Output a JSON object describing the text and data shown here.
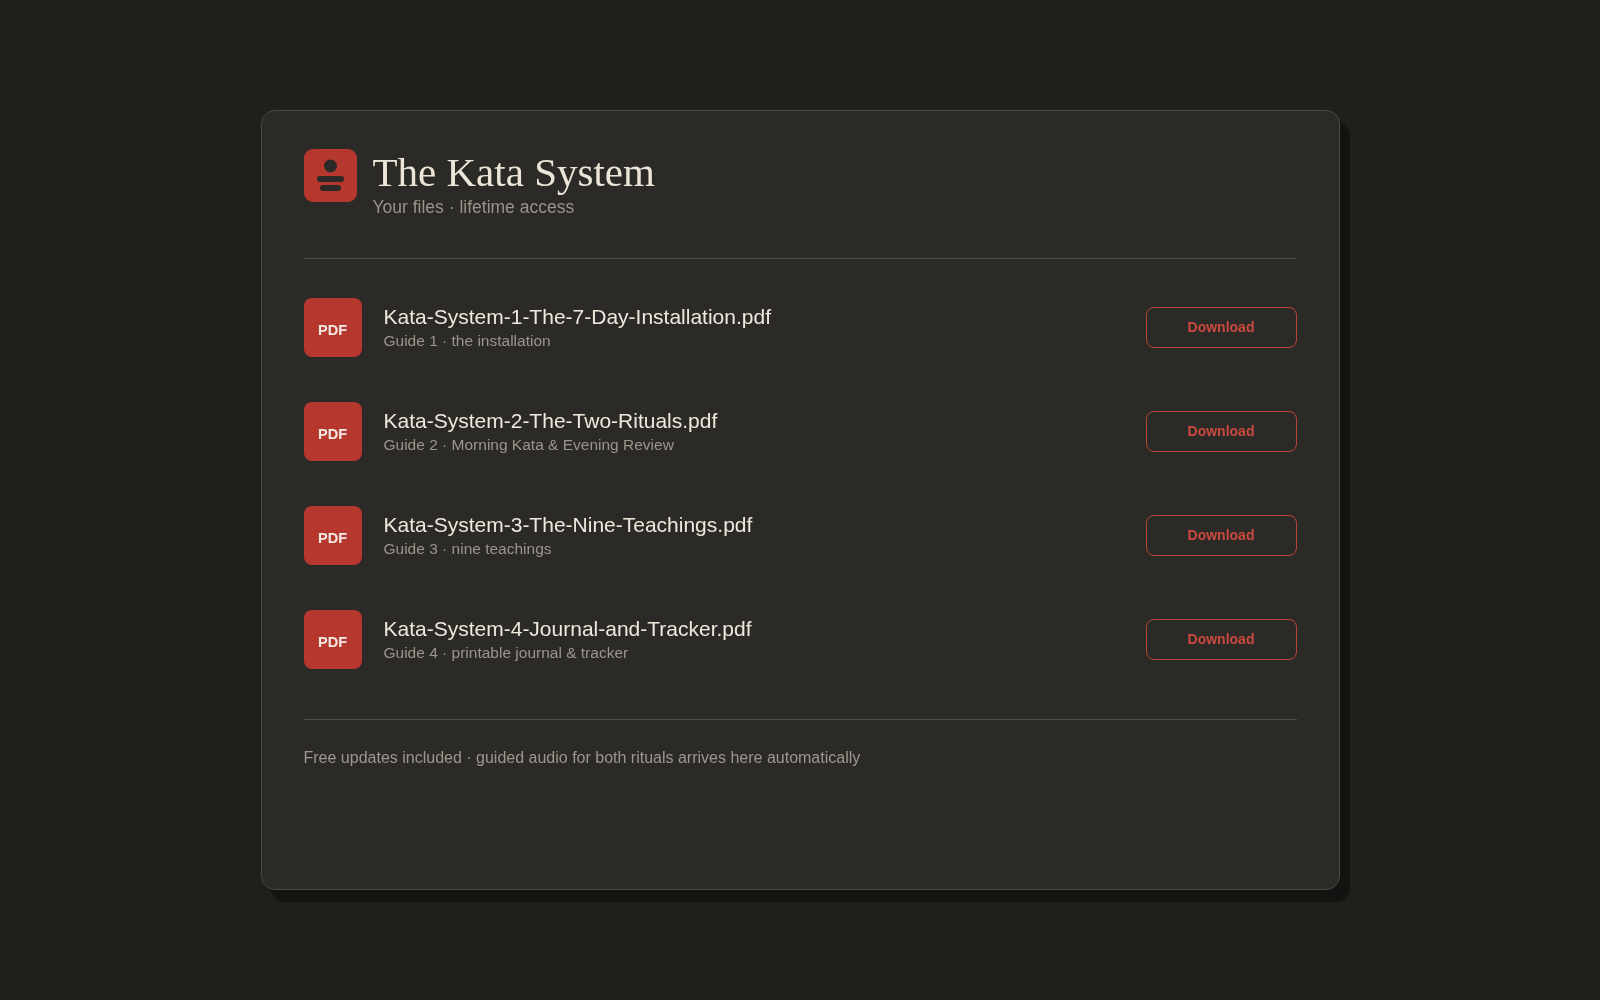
{
  "header": {
    "title": "The Kata System",
    "subtitle": "Your files · lifetime access"
  },
  "files": [
    {
      "type": "PDF",
      "name": "Kata-System-1-The-7-Day-Installation.pdf",
      "description": "Guide 1 · the installation",
      "action": "Download"
    },
    {
      "type": "PDF",
      "name": "Kata-System-2-The-Two-Rituals.pdf",
      "description": "Guide 2 · Morning Kata & Evening Review",
      "action": "Download"
    },
    {
      "type": "PDF",
      "name": "Kata-System-3-The-Nine-Teachings.pdf",
      "description": "Guide 3 · nine teachings",
      "action": "Download"
    },
    {
      "type": "PDF",
      "name": "Kata-System-4-Journal-and-Tracker.pdf",
      "description": "Guide 4 · printable journal & tracker",
      "action": "Download"
    }
  ],
  "footer": "Free updates included · guided audio for both rituals arrives here automatically"
}
